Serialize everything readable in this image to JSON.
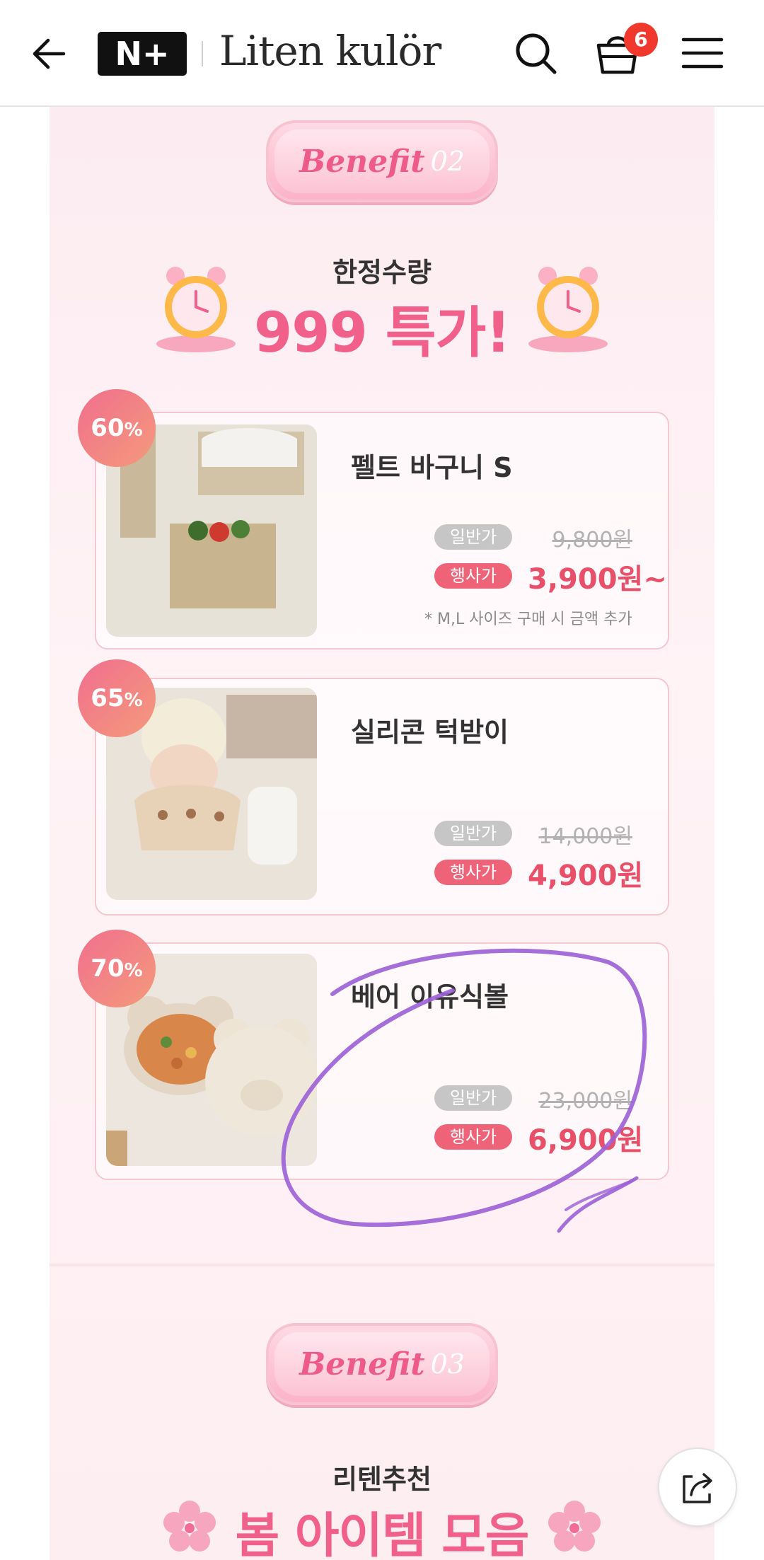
{
  "header": {
    "logo_text": "N+",
    "brand": "Liten kulör",
    "cart_count": "6"
  },
  "benefit2": {
    "word": "Benefit",
    "num": "02",
    "subtitle": "한정수량",
    "headline": "999 특가!"
  },
  "products": [
    {
      "discount": "60",
      "name": "펠트 바구니 S",
      "regular_label": "일반가",
      "regular_price": "9,800원",
      "sale_label": "행사가",
      "sale_price": "3,900원~",
      "note": "* M,L 사이즈 구매 시 금액 추가"
    },
    {
      "discount": "65",
      "name": "실리콘 턱받이",
      "regular_label": "일반가",
      "regular_price": "14,000원",
      "sale_label": "행사가",
      "sale_price": "4,900원"
    },
    {
      "discount": "70",
      "name": "베어 이유식볼",
      "regular_label": "일반가",
      "regular_price": "23,000원",
      "sale_label": "행사가",
      "sale_price": "6,900원"
    }
  ],
  "benefit3": {
    "word": "Benefit",
    "num": "03",
    "subtitle": "리텐추천",
    "headline": "봄 아이템 모음"
  },
  "colors": {
    "accent": "#f0608a",
    "sale": "#e8506a",
    "annotation": "#9b5fd6",
    "badge": "#f0382c"
  },
  "icons": [
    "back-arrow-icon",
    "search-icon",
    "shopping-bag-icon",
    "hamburger-menu-icon",
    "share-icon",
    "alarm-clock-icon",
    "cherry-blossom-icon"
  ]
}
